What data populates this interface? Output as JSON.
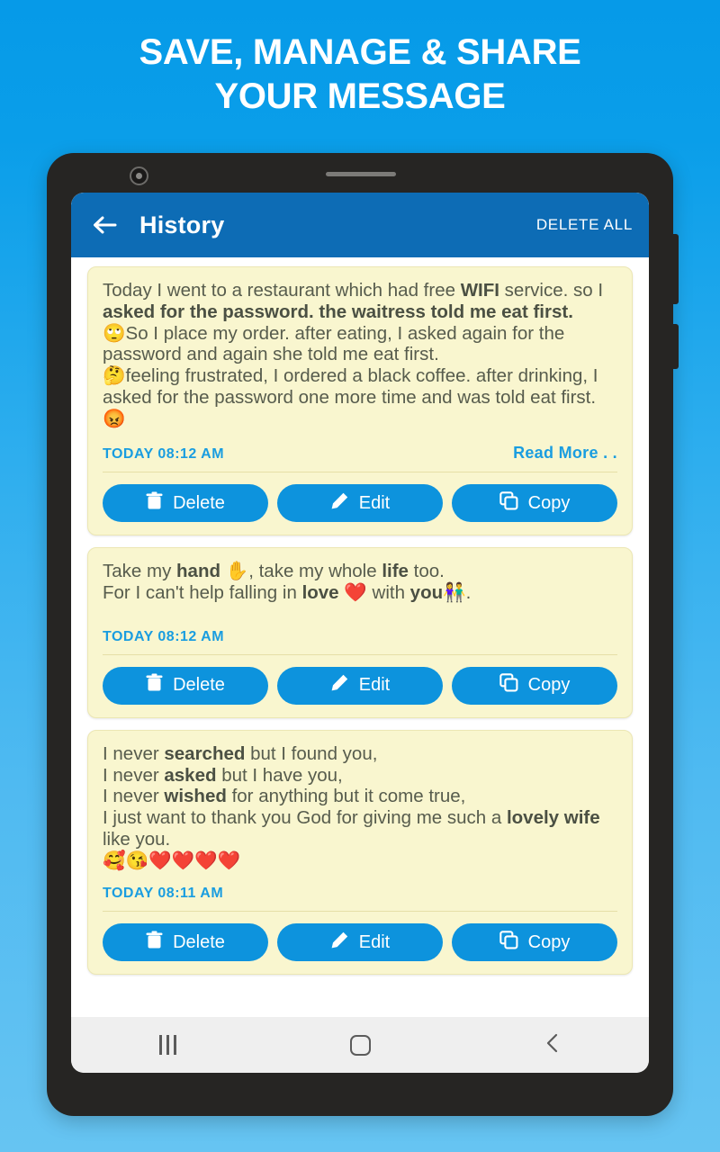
{
  "promo": {
    "headline_line1": "SAVE, MANAGE & SHARE",
    "headline_line2": "YOUR MESSAGE",
    "background_top_color": "#069ae8",
    "background_bottom_color": "#66c4f2"
  },
  "appbar": {
    "back_icon": "arrow-left-icon",
    "title": "History",
    "delete_all_label": "DELETE ALL",
    "background_color": "#0d6cb5"
  },
  "buttons": {
    "delete_label": "Delete",
    "edit_label": "Edit",
    "copy_label": "Copy",
    "color": "#0d93dd"
  },
  "cards": [
    {
      "time": "TODAY 08:12 AM",
      "read_more_label": "Read More . .",
      "text_segments": [
        {
          "text": "Today I went to a restaurant which had free ",
          "bold": false
        },
        {
          "text": "WIFI",
          "bold": true
        },
        {
          "text": " service. so I ",
          "bold": false
        },
        {
          "text": "asked for the password. the waitress told me eat first.",
          "bold": true
        },
        {
          "text": "\n",
          "bold": false
        },
        {
          "text": "🙄",
          "bold": false
        },
        {
          "text": "So I place my order. after eating, I asked again for the password and again she told me eat first.",
          "bold": false
        },
        {
          "text": "\n",
          "bold": false
        },
        {
          "text": "🤔",
          "bold": false
        },
        {
          "text": "feeling frustrated,  I ordered a black coffee. after drinking, I asked for the password one more time and was told eat first.",
          "bold": false
        },
        {
          "text": "\n",
          "bold": false
        },
        {
          "text": "😡",
          "bold": false
        }
      ]
    },
    {
      "time": "TODAY 08:12 AM",
      "read_more_label": "",
      "text_segments": [
        {
          "text": "Take my ",
          "bold": false
        },
        {
          "text": "hand",
          "bold": true
        },
        {
          "text": " ✋, take my whole ",
          "bold": false
        },
        {
          "text": "life",
          "bold": true
        },
        {
          "text": " too.",
          "bold": false
        },
        {
          "text": "\n",
          "bold": false
        },
        {
          "text": "For I can't help falling in ",
          "bold": false
        },
        {
          "text": "love",
          "bold": true
        },
        {
          "text": " ❤️ with ",
          "bold": false
        },
        {
          "text": "you",
          "bold": true
        },
        {
          "text": "👫.",
          "bold": false
        }
      ]
    },
    {
      "time": "TODAY 08:11 AM",
      "read_more_label": "",
      "text_segments": [
        {
          "text": "I never ",
          "bold": false
        },
        {
          "text": "searched",
          "bold": true
        },
        {
          "text": " but I found you,",
          "bold": false
        },
        {
          "text": "\n",
          "bold": false
        },
        {
          "text": "I never ",
          "bold": false
        },
        {
          "text": "asked",
          "bold": true
        },
        {
          "text": " but I have you,",
          "bold": false
        },
        {
          "text": "\n",
          "bold": false
        },
        {
          "text": "I never ",
          "bold": false
        },
        {
          "text": "wished",
          "bold": true
        },
        {
          "text": " for anything but it come true,",
          "bold": false
        },
        {
          "text": "\n",
          "bold": false
        },
        {
          "text": "I just want to thank you God for giving me such a ",
          "bold": false
        },
        {
          "text": "lovely wife",
          "bold": true
        },
        {
          "text": " like you.",
          "bold": false
        },
        {
          "text": "\n",
          "bold": false
        },
        {
          "text": "🥰😘❤️❤️❤️❤️",
          "bold": false
        }
      ]
    }
  ],
  "navbar": {
    "recents_label": "recents",
    "home_label": "home",
    "back_label": "back"
  }
}
